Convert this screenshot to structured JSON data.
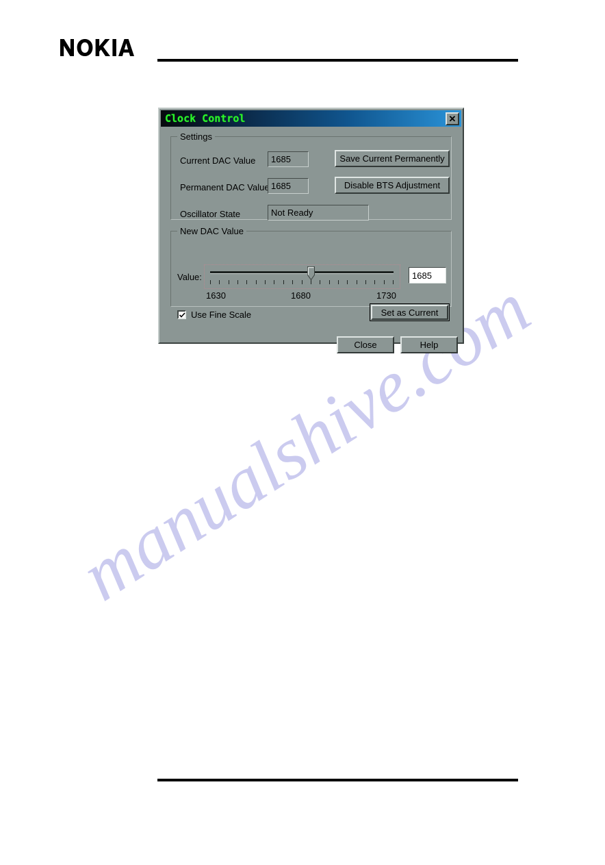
{
  "page": {
    "brand": "NOKIA",
    "watermark": "manualshive.com"
  },
  "dialog": {
    "title": "Clock Control",
    "close_icon": "close-icon",
    "settings_group": {
      "legend": "Settings",
      "rows": [
        {
          "label": "Current DAC Value",
          "value": "1685"
        },
        {
          "label": "Permanent DAC Value",
          "value": "1685"
        },
        {
          "label": "Oscillator State",
          "value": "Not Ready"
        }
      ],
      "buttons": [
        {
          "label": "Save Current Permanently"
        },
        {
          "label": "Disable BTS Adjustment"
        }
      ]
    },
    "newdac_group": {
      "legend": "New DAC Value",
      "value_label": "Value:",
      "value": "1685",
      "slider": {
        "min": 1630,
        "max": 1730,
        "current": 1685,
        "tick_count": 21,
        "scale_min_label": "1630",
        "scale_mid_label": "1680",
        "scale_max_label": "1730"
      },
      "checkbox": {
        "label": "Use Fine Scale",
        "checked": true
      },
      "set_button": {
        "label": "Set as Current"
      }
    },
    "footer_buttons": [
      {
        "label": "Close"
      },
      {
        "label": "Help"
      }
    ]
  },
  "colors": {
    "dialog_face": "#8b9694",
    "title_text": "#2bf32b",
    "title_gradient_start": "#07090d",
    "title_gradient_end": "#2a93d8",
    "watermark": "#c9c9ef"
  }
}
